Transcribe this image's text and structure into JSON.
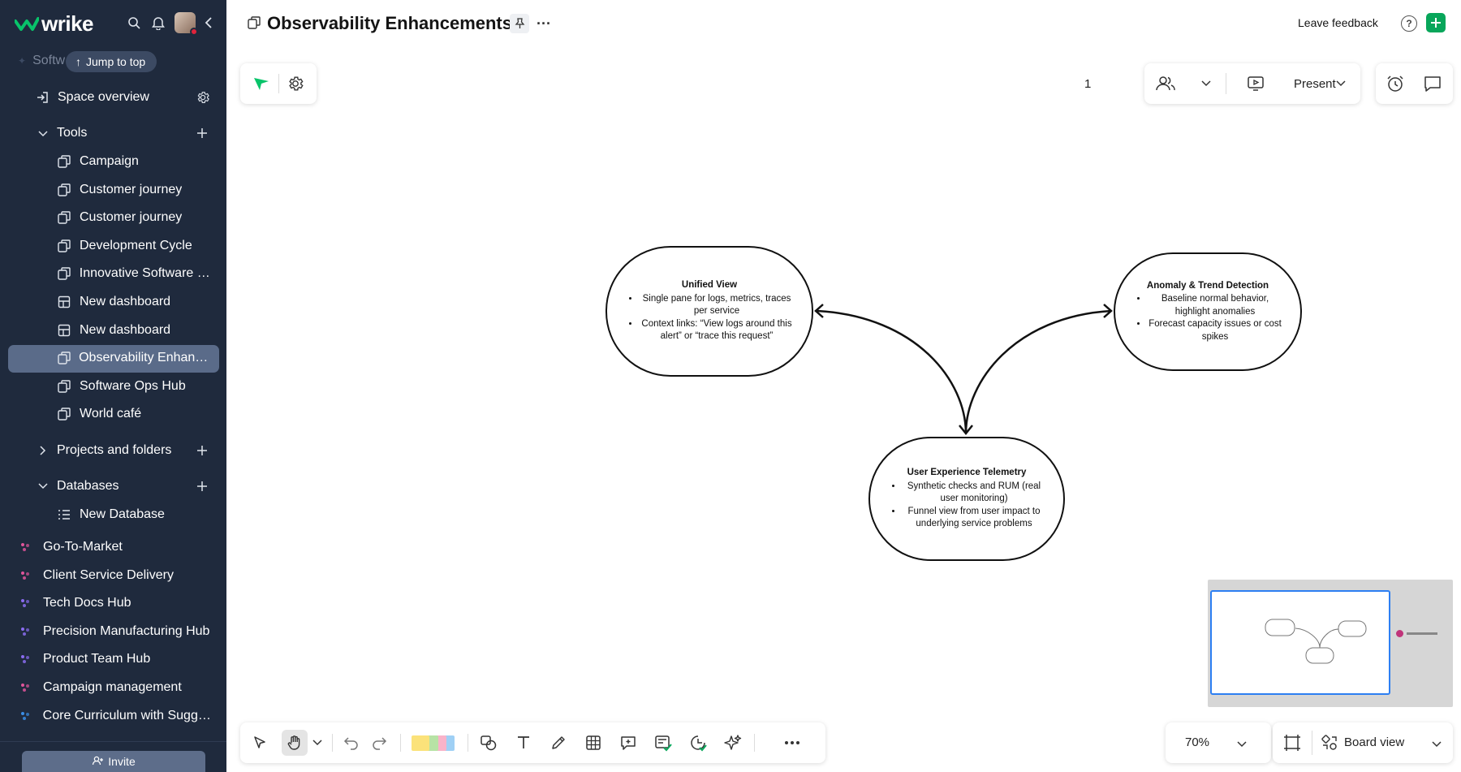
{
  "app": {
    "name": "wrike"
  },
  "sidebar": {
    "space_name": "Softw",
    "jump_label": "Jump to top",
    "space_overview": "Space overview",
    "sections": {
      "tools": "Tools",
      "projects": "Projects and folders",
      "databases": "Databases"
    },
    "tools_items": [
      {
        "label": "Campaign",
        "icon": "whiteboard-icon"
      },
      {
        "label": "Customer journey",
        "icon": "whiteboard-icon"
      },
      {
        "label": "Customer journey",
        "icon": "whiteboard-icon"
      },
      {
        "label": "Development Cycle",
        "icon": "whiteboard-icon"
      },
      {
        "label": "Innovative Software F...",
        "icon": "whiteboard-icon"
      },
      {
        "label": "New dashboard",
        "icon": "dashboard-icon"
      },
      {
        "label": "New dashboard",
        "icon": "dashboard-icon"
      },
      {
        "label": "Observability Enhance...",
        "icon": "whiteboard-icon",
        "selected": true
      },
      {
        "label": "Software Ops Hub",
        "icon": "whiteboard-icon"
      },
      {
        "label": "World café",
        "icon": "whiteboard-icon"
      }
    ],
    "database_items": [
      {
        "label": "New Database",
        "icon": "database-icon"
      }
    ],
    "spaces": [
      {
        "label": "Go-To-Market",
        "color": "#e0559a"
      },
      {
        "label": "Client Service Delivery",
        "color": "#e0559a"
      },
      {
        "label": "Tech Docs Hub",
        "color": "#8a6cf0"
      },
      {
        "label": "Precision Manufacturing Hub",
        "color": "#8a6cf0"
      },
      {
        "label": "Product Team Hub",
        "color": "#8a6cf0"
      },
      {
        "label": "Campaign management",
        "color": "#e0559a"
      },
      {
        "label": "Core Curriculum with Sugge...",
        "color": "#3a8ee6"
      }
    ],
    "invite_label": "Invite"
  },
  "header": {
    "title": "Observability Enhancements",
    "feedback": "Leave feedback",
    "help": "?"
  },
  "toolbar_top": {
    "people_count": "1",
    "present_label": "Present"
  },
  "diagram": {
    "nodes": [
      {
        "title": "Unified View",
        "bullets": [
          "Single pane for logs, metrics, traces per service",
          "Context links: “View logs around this alert” or “trace this request”"
        ]
      },
      {
        "title": "Anomaly & Trend Detection",
        "bullets": [
          "Baseline normal behavior, highlight anomalies",
          "Forecast capacity issues or cost spikes"
        ]
      },
      {
        "title": "User Experience Telemetry",
        "bullets": [
          "Synthetic checks and RUM (real user monitoring)",
          "Funnel view from user impact to underlying service problems"
        ]
      }
    ]
  },
  "bottom": {
    "zoom": "70%",
    "view_label": "Board view"
  },
  "colors": {
    "sidebar_bg": "#1f2a3d",
    "selected_bg": "#5a6b89",
    "accent_green": "#08a65a",
    "minimap_frame": "#2d7ff2"
  }
}
